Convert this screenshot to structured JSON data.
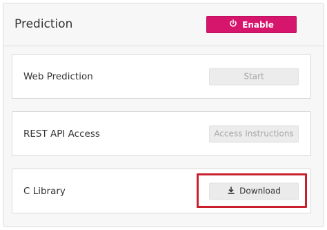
{
  "panel": {
    "title": "Prediction",
    "enable_label": "Enable"
  },
  "cards": [
    {
      "label": "Web Prediction",
      "button": "Start"
    },
    {
      "label": "REST API Access",
      "button": "Access Instructions"
    },
    {
      "label": "C Library",
      "button": "Download"
    }
  ],
  "colors": {
    "enable_accent": "#d6156c",
    "highlight": "#c8202c"
  },
  "icons": {
    "enable": "power-icon",
    "download": "download-icon"
  }
}
